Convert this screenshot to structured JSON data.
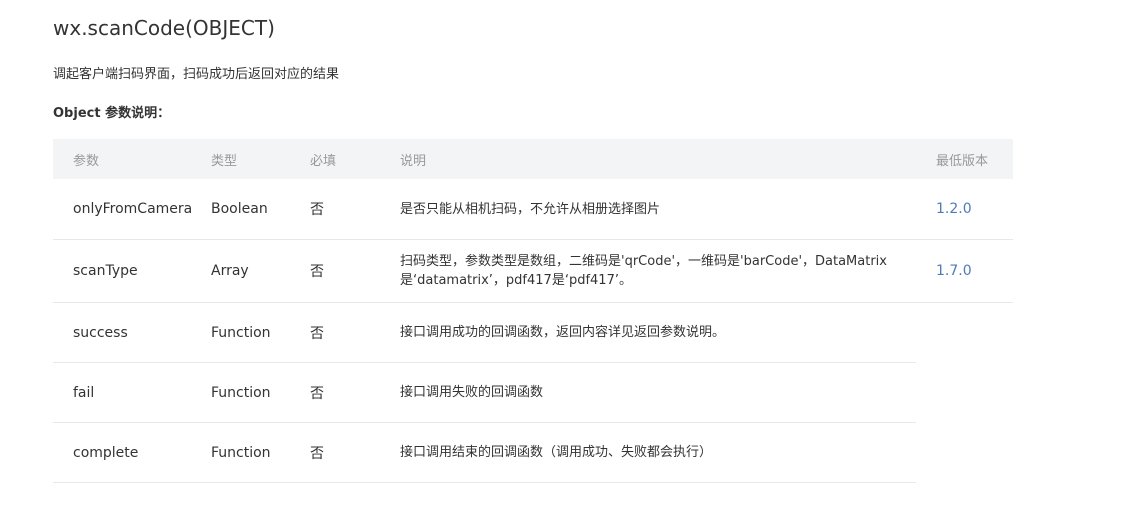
{
  "title": "wx.scanCode(OBJECT)",
  "description": "调起客户端扫码界面，扫码成功后返回对应的结果",
  "section_title": "Object 参数说明：",
  "table": {
    "headers": {
      "param": "参数",
      "type": "类型",
      "required": "必填",
      "description": "说明",
      "version": "最低版本"
    },
    "rows": [
      {
        "param": "onlyFromCamera",
        "type": "Boolean",
        "required": "否",
        "description": "是否只能从相机扫码，不允许从相册选择图片",
        "version": "1.2.0"
      },
      {
        "param": "scanType",
        "type": "Array",
        "required": "否",
        "description": "扫码类型，参数类型是数组，二维码是'qrCode'，一维码是'barCode'，DataMatrix是‘datamatrix’，pdf417是‘pdf417’。",
        "version": "1.7.0"
      },
      {
        "param": "success",
        "type": "Function",
        "required": "否",
        "description": "接口调用成功的回调函数，返回内容详见返回参数说明。",
        "version": ""
      },
      {
        "param": "fail",
        "type": "Function",
        "required": "否",
        "description": "接口调用失败的回调函数",
        "version": ""
      },
      {
        "param": "complete",
        "type": "Function",
        "required": "否",
        "description": "接口调用结束的回调函数（调用成功、失败都会执行）",
        "version": ""
      }
    ]
  },
  "colors": {
    "text": "#333333",
    "header_text": "#999999",
    "header_bg": "#f3f4f5",
    "link": "#4f7ab8",
    "divider": "#e8e8e8"
  }
}
